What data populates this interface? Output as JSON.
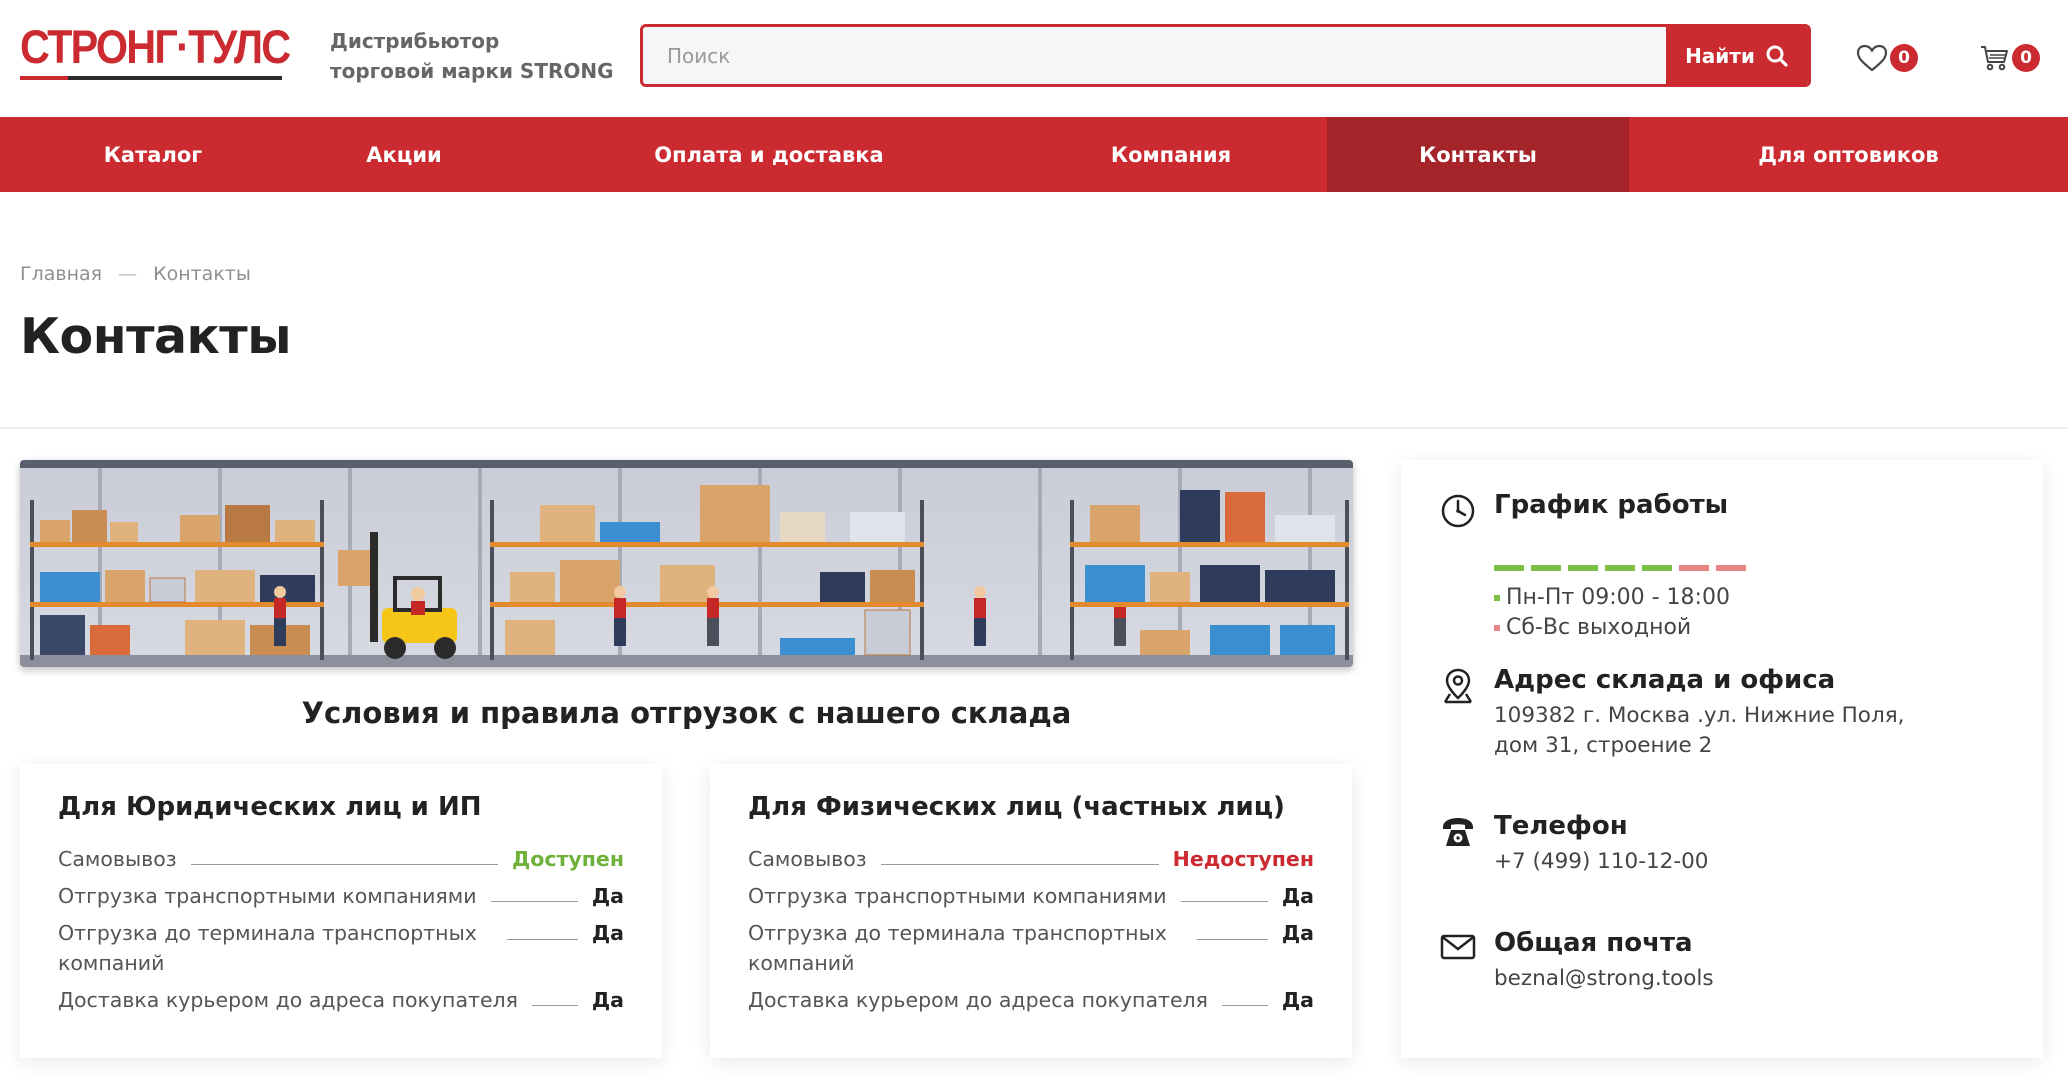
{
  "header": {
    "logo_text": "СТРОНГ·ТУЛС",
    "tagline_line1": "Дистрибьютор",
    "tagline_line2": "торговой марки STRONG",
    "search_placeholder": "Поиск",
    "search_button": "Найти",
    "favorites_count": "0",
    "cart_count": "0"
  },
  "nav": {
    "items": [
      {
        "label": "Каталог"
      },
      {
        "label": "Акции"
      },
      {
        "label": "Оплата и доставка"
      },
      {
        "label": "Компания"
      },
      {
        "label": "Контакты"
      },
      {
        "label": "Для оптовиков"
      }
    ]
  },
  "breadcrumb": {
    "home": "Главная",
    "separator": "—",
    "current": "Контакты"
  },
  "page": {
    "title": "Контакты",
    "section_title": "Условия и правила отгрузок с нашего склада"
  },
  "cards": {
    "legal": {
      "title": "Для Юридических лиц и ИП",
      "rows": [
        {
          "label": "Самовывоз",
          "value": "Доступен"
        },
        {
          "label": "Отгрузка транспортными компаниями",
          "value": "Да"
        },
        {
          "label": "Отгрузка до терминала транспортных компаний",
          "value": "Да"
        },
        {
          "label": "Доставка курьером до адреса покупателя",
          "value": "Да"
        }
      ]
    },
    "private": {
      "title": "Для Физических лиц (частных лиц)",
      "rows": [
        {
          "label": "Самовывоз",
          "value": "Недоступен"
        },
        {
          "label": "Отгрузка транспортными компаниями",
          "value": "Да"
        },
        {
          "label": "Отгрузка до терминала транспортных компаний",
          "value": "Да"
        },
        {
          "label": "Доставка курьером до адреса покупателя",
          "value": "Да"
        }
      ]
    }
  },
  "contacts": {
    "schedule": {
      "title": "График работы",
      "weekdays": "Пн-Пт 09:00 - 18:00",
      "weekend": "Сб-Вс выходной"
    },
    "address": {
      "title": "Адрес склада и офиса",
      "line1": "109382 г. Москва .ул. Нижние Поля,",
      "line2": "дом 31, строение 2"
    },
    "phone": {
      "title": "Телефон",
      "value": "+7 (499) 110-12-00"
    },
    "email": {
      "title": "Общая почта",
      "value": "beznal@strong.tools"
    }
  },
  "colors": {
    "brand_red": "#cb2a30",
    "nav_active": "#a4242a",
    "status_ok": "#6fb13b",
    "schedule_green": "#7cbf46",
    "schedule_red": "#e88585"
  },
  "icons": {
    "search": "search-icon",
    "favorites": "heart-icon",
    "cart": "cart-icon",
    "schedule": "clock-icon",
    "address": "location-pin-icon",
    "phone": "phone-icon",
    "email": "envelope-icon"
  }
}
